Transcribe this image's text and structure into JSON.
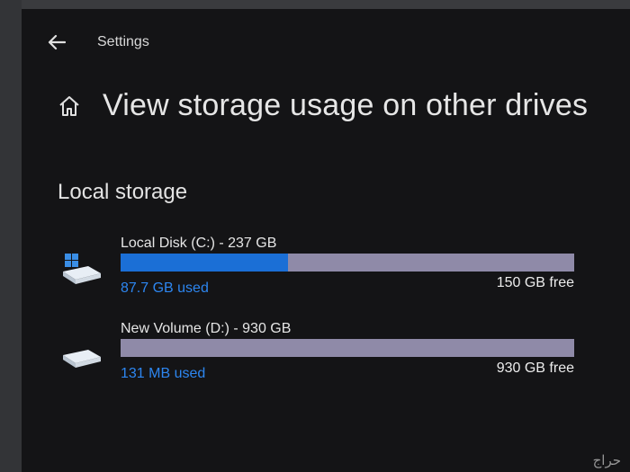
{
  "app": {
    "title": "Settings"
  },
  "page": {
    "title": "View storage usage on other drives"
  },
  "section": {
    "title": "Local storage"
  },
  "drives": [
    {
      "name": "Local Disk (C:) - 237 GB",
      "used": "87.7 GB used",
      "free": "150 GB free",
      "used_fraction": 0.37
    },
    {
      "name": "New Volume (D:) - 930 GB",
      "used": "131 MB used",
      "free": "930 GB free",
      "used_fraction": 0.0
    }
  ],
  "colors": {
    "accent": "#1b6fd6",
    "used_text": "#2d86f0",
    "bar_track": "#8f8aa8",
    "background": "#141416"
  },
  "icons": {
    "back": "back-arrow-icon",
    "home": "home-icon",
    "system_drive": "windows-drive-icon",
    "data_drive": "drive-icon"
  },
  "watermark": "حراج"
}
